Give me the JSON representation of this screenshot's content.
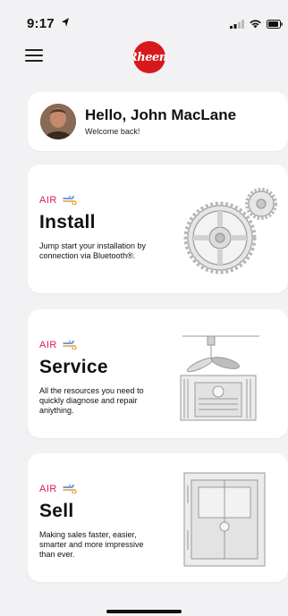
{
  "status_bar": {
    "time": "9:17"
  },
  "brand": {
    "logo_text": "Rheem",
    "color": "#d7191d"
  },
  "welcome": {
    "greeting": "Hello, John MacLane",
    "subtitle": "Welcome back!"
  },
  "cards": [
    {
      "tag": "AIR",
      "title": "Install",
      "description": "Jump start your installation by connection via Bluetooth®.",
      "image": "gear-illustration"
    },
    {
      "tag": "AIR",
      "title": "Service",
      "description": "All the resources you need to quickly diagnose and repair aniything.",
      "image": "condenser-unit-illustration"
    },
    {
      "tag": "AIR",
      "title": "Sell",
      "description": "Making sales faster, easier, smarter and more impressive than ever.",
      "image": "furnace-unit-illustration"
    }
  ],
  "colors": {
    "accent_red": "#d81f4a",
    "accent_blue": "#3b7fd8",
    "accent_orange": "#f09a2b"
  }
}
